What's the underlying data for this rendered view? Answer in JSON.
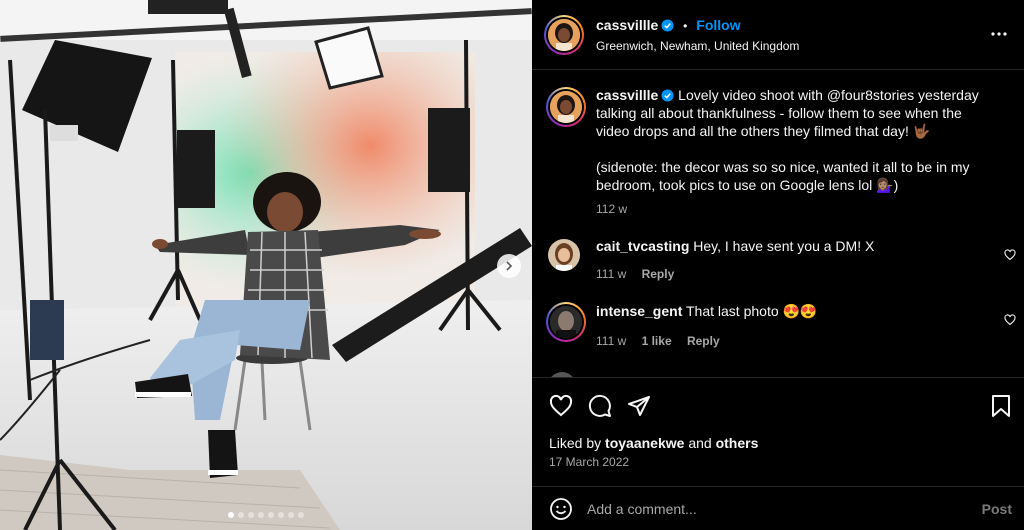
{
  "post": {
    "author": "cassvillle",
    "follow_label": "Follow",
    "separator": "•",
    "location": "Greenwich, Newham, United Kingdom",
    "caption_line1": "Lovely video shoot with @four8stories yesterday",
    "caption_line2": "talking all about thankfulness - follow them to see when the",
    "caption_line3": "video drops and all the others they filmed that day! 🤟🏾",
    "caption_line4": "(sidenote: the decor was so so nice, wanted it all to be in my",
    "caption_line5": "bedroom, took pics to use on Google lens lol 💁🏽‍♀️)",
    "caption_time": "112 w"
  },
  "comments": [
    {
      "user": "cait_tvcasting",
      "text": "Hey, I have sent you a DM! X",
      "time": "111 w",
      "likes": "",
      "reply": "Reply"
    },
    {
      "user": "intense_gent",
      "text": "That last photo 😍😍",
      "time": "111 w",
      "likes": "1 like",
      "reply": "Reply"
    }
  ],
  "likes": {
    "prefix": "Liked by",
    "user": "toyaanekwe",
    "and": "and",
    "others": "others"
  },
  "date": "17 March 2022",
  "add_comment": {
    "placeholder": "Add a comment...",
    "post_label": "Post"
  },
  "carousel": {
    "count": 8,
    "active": 0
  },
  "colors": {
    "accent": "#0095f6",
    "background": "#000000",
    "secondary_text": "#a8a8a8",
    "divider": "#262626"
  },
  "icons": [
    "verified-badge-icon",
    "more-options-icon",
    "heart-icon",
    "comment-icon",
    "share-icon",
    "save-icon",
    "emoji-icon",
    "chevron-right-icon"
  ]
}
